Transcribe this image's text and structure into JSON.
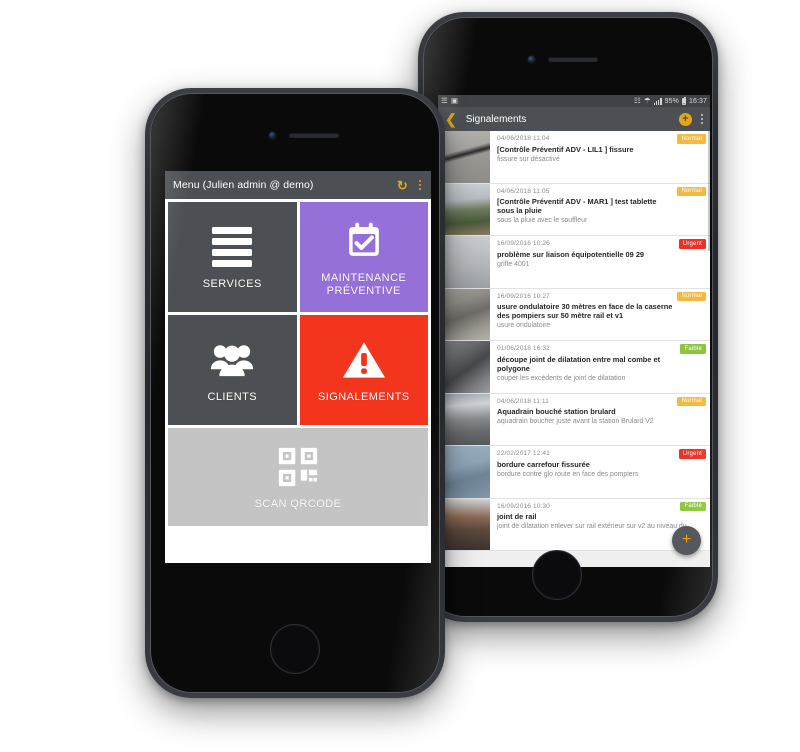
{
  "phone_left": {
    "appbar": {
      "title": "Menu (Julien admin @ demo)",
      "refresh_icon": "refresh-icon",
      "overflow_icon": "kebab-menu-icon"
    },
    "tiles": [
      {
        "label": "SERVICES",
        "icon": "hamburger-bars-icon",
        "color": "#4c4f53"
      },
      {
        "label": "MAINTENANCE PRÉVENTIVE",
        "icon": "calendar-check-icon",
        "color": "#9570d8"
      },
      {
        "label": "CLIENTS",
        "icon": "people-group-icon",
        "color": "#4c4f53"
      },
      {
        "label": "SIGNALEMENTS",
        "icon": "warning-triangle-icon",
        "color": "#f4351d"
      },
      {
        "label": "SCAN QRCODE",
        "icon": "qr-code-icon",
        "color": "#c4c4c4"
      }
    ]
  },
  "phone_right": {
    "statusbar": {
      "left_icons": [
        "android-share-icon",
        "image-icon"
      ],
      "signal_icon": "cell-signal-icon",
      "wifi_icon": "wifi-icon",
      "battery_percent": "95%",
      "battery_icon": "battery-icon",
      "clock": "16:37"
    },
    "appbar": {
      "back_icon": "chevron-left-icon",
      "title": "Signalements",
      "add_icon": "plus-circle-icon",
      "overflow_icon": "kebab-menu-icon"
    },
    "fab": {
      "icon": "plus-icon",
      "label": "+"
    },
    "items": [
      {
        "date": "04/06/2018 11:04",
        "title": "[Contrôle Préventif ADV - LIL1 ] fissure",
        "subtitle": "fissure sur désactivé",
        "badge": "Normal",
        "badge_color": "#f5b942",
        "thumb": "th1"
      },
      {
        "date": "04/06/2018 11:05",
        "title": "[Contrôle Préventif ADV - MAR1 ] test tablette sous la pluie",
        "subtitle": "sous la pluie avec le souffleur",
        "badge": "Normal",
        "badge_color": "#f5b942",
        "thumb": "th2"
      },
      {
        "date": "16/09/2016 10:26",
        "title": "problème sur liaison équipotentielle 09 29",
        "subtitle": "griffe 4001",
        "badge": "Urgent",
        "badge_color": "#ee3124",
        "thumb": "th3"
      },
      {
        "date": "16/09/2016 10:27",
        "title": "usure ondulatoire 30 mètres en face de la caserne des pompiers sur 50 mètre rail et v1",
        "subtitle": "usure ondulatoire",
        "badge": "Normal",
        "badge_color": "#f5b942",
        "thumb": "th4"
      },
      {
        "date": "01/06/2018 16:32",
        "title": "découpe joint de dilatation entre mal combe et polygone",
        "subtitle": "couper les excédents de joint de dilatation",
        "badge": "Faible",
        "badge_color": "#8cc63f",
        "thumb": "th5"
      },
      {
        "date": "04/06/2018 11:11",
        "title": "Aquadrain bouché station brulard",
        "subtitle": "aquadrain boucher juste avant la station Brulard V2",
        "badge": "Normal",
        "badge_color": "#f5b942",
        "thumb": "th6"
      },
      {
        "date": "22/02/2017 12:41",
        "title": "bordure carrefour fissurée",
        "subtitle": "bordure contre glo route en face des pompiers",
        "badge": "Urgent",
        "badge_color": "#ee3124",
        "thumb": "th7"
      },
      {
        "date": "16/09/2016 10:30",
        "title": "joint de rail",
        "subtitle": "joint de dilatation enlever sur rail extérieur sur v2 au niveau du",
        "badge": "Faible",
        "badge_color": "#8cc63f",
        "thumb": "th8"
      }
    ]
  }
}
